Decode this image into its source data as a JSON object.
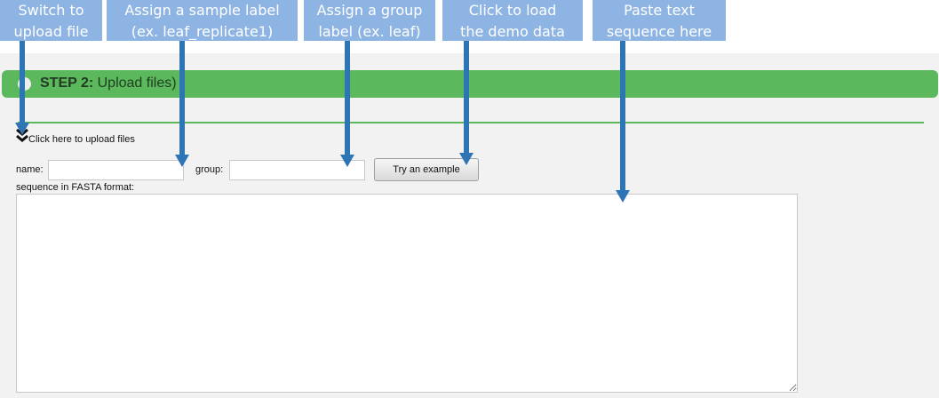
{
  "callouts": [
    {
      "line1": "Switch to",
      "line2": "upload file"
    },
    {
      "line1": "Assign a sample label",
      "line2": "(ex. leaf_replicate1)"
    },
    {
      "line1": "Assign a group",
      "line2": "label  (ex. leaf)"
    },
    {
      "line1": "Click to load",
      "line2": "the demo data"
    },
    {
      "line1": "Paste text",
      "line2": "sequence here"
    }
  ],
  "step": {
    "number_label": "STEP 2:",
    "title": "Upload files)"
  },
  "upload_toggle": {
    "icon": "double-chevron-down-icon",
    "label": "Click here to upload files"
  },
  "form": {
    "name_label": "name:",
    "name_value": "",
    "group_label": "group:",
    "group_value": "",
    "example_button": "Try an example",
    "sequence_label": "sequence in FASTA format:",
    "sequence_value": ""
  },
  "colors": {
    "step_bar": "#5cb85c",
    "callout_bg": "#8eb4e3",
    "arrow": "#2e75b6"
  }
}
